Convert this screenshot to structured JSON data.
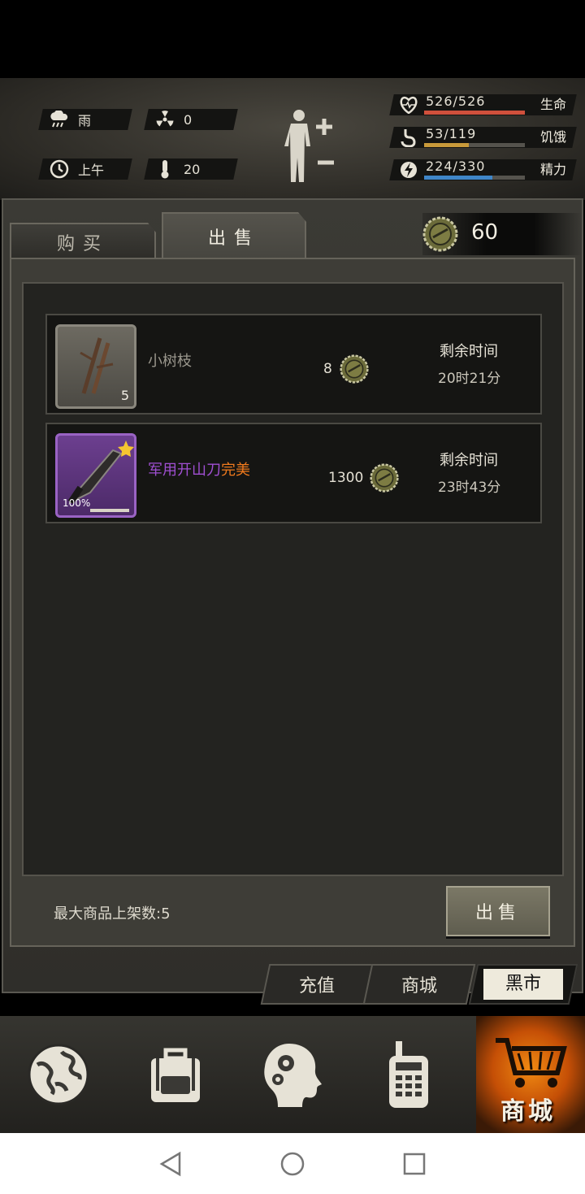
{
  "hud": {
    "weather": "雨",
    "radiation": "0",
    "time_of_day": "上午",
    "temperature": "20",
    "stats": [
      {
        "icon": "heart-icon",
        "value": "526/526",
        "label": "生命",
        "fill": 1.0,
        "color": "#d0503c"
      },
      {
        "icon": "stomach-icon",
        "value": "53/119",
        "label": "饥饿",
        "fill": 0.445,
        "color": "#c99a3a"
      },
      {
        "icon": "energy-icon",
        "value": "224/330",
        "label": "精力",
        "fill": 0.679,
        "color": "#3f86c8"
      }
    ]
  },
  "tabs": {
    "buy": "购买",
    "sell": "出售"
  },
  "currency": {
    "icon": "bottle-cap-icon",
    "amount": "60"
  },
  "listings": [
    {
      "name": "小树枝",
      "quality": "",
      "quantity": "5",
      "price": "8",
      "time_label": "剩余时间",
      "time_value": "20时21分"
    },
    {
      "name": "军用开山刀",
      "quality": "完美",
      "durability": "100%",
      "price": "1300",
      "time_label": "剩余时间",
      "time_value": "23时43分"
    }
  ],
  "footer": {
    "max_listings": "最大商品上架数:5",
    "sell_button": "出售"
  },
  "shop_tabs": {
    "recharge": "充值",
    "mall": "商城",
    "black_market": "黑市"
  },
  "nav": {
    "active_label": "商城"
  }
}
